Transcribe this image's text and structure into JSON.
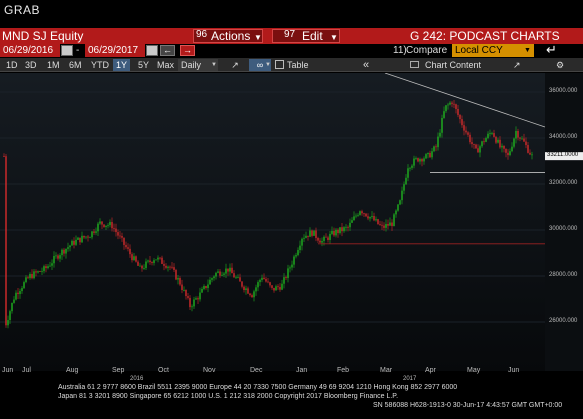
{
  "window": {
    "title": "GRAB"
  },
  "function_bar": {
    "ticker": "MND SJ Equity",
    "actions": {
      "number": "96",
      "label": "Actions"
    },
    "edit": {
      "number": "97",
      "label": "Edit"
    },
    "page_title": "G 242: PODCAST CHARTS"
  },
  "date_row": {
    "start_date": "06/29/2016",
    "end_date": "06/29/2017",
    "compare_number": "11)",
    "compare_label": "Compare",
    "currency": "Local CCY"
  },
  "toolbar": {
    "ranges": [
      "1D",
      "3D",
      "1M",
      "6M",
      "YTD",
      "1Y",
      "5Y",
      "Max"
    ],
    "selected_range": "1Y",
    "frequency": "Daily",
    "table_label": "Table",
    "chart_content_label": "Chart Content"
  },
  "chart_data": {
    "type": "candlestick",
    "y_ticks": [
      "36000.000",
      "34000.000",
      "32000.000",
      "30000.000",
      "28000.000",
      "26000.000"
    ],
    "last_price_label": "33211.0000",
    "x_labels": [
      "Jun",
      "Jul",
      "Aug",
      "Sep",
      "Oct",
      "Nov",
      "Dec",
      "Jan",
      "Feb",
      "Mar",
      "Apr",
      "May",
      "Jun"
    ],
    "year_labels": [
      "2016",
      "2017"
    ],
    "colors": {
      "up": "#1fb51f",
      "down": "#d62b2b",
      "trendline": "#bbbbbb",
      "support": "#dddddd",
      "resistance_red": "#9b2222"
    }
  },
  "footer": {
    "line1": "Australia 61 2 9777 8600 Brazil 5511 2395 9000 Europe 44 20 7330 7500 Germany 49 69 9204 1210 Hong Kong 852 2977 6000",
    "line2": "Japan 81 3 3201 8900 Singapore 65 6212 1000 U.S. 1 212 318 2000 Copyright 2017 Bloomberg Finance L.P.",
    "line3": "SN 586088 H628-1913-0 30-Jun-17 4:43:57 GMT GMT+0:00"
  }
}
